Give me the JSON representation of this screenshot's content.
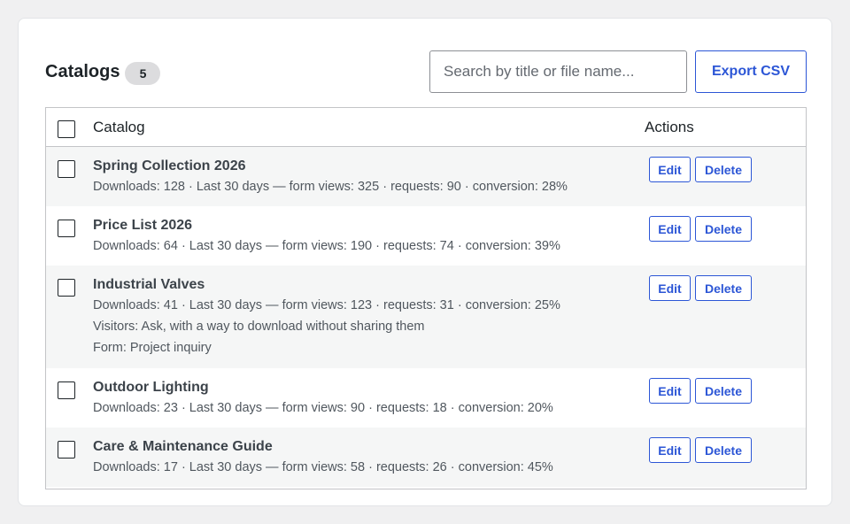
{
  "header": {
    "title": "Catalogs",
    "count": "5",
    "search_placeholder": "Search by title or file name...",
    "export_label": "Export CSV"
  },
  "table": {
    "col_catalog": "Catalog",
    "col_actions": "Actions",
    "edit_label": "Edit",
    "delete_label": "Delete",
    "rows": [
      {
        "title": "Spring Collection 2026",
        "lines": [
          "Downloads: 128 · Last 30 days — form views: 325 · requests: 90 · conversion: 28%"
        ]
      },
      {
        "title": "Price List 2026",
        "lines": [
          "Downloads: 64 · Last 30 days — form views: 190 · requests: 74 · conversion: 39%"
        ]
      },
      {
        "title": "Industrial Valves",
        "lines": [
          "Downloads: 41 · Last 30 days — form views: 123 · requests: 31 · conversion: 25%",
          "Visitors: Ask, with a way to download without sharing them",
          "Form: Project inquiry"
        ]
      },
      {
        "title": "Outdoor Lighting",
        "lines": [
          "Downloads: 23 · Last 30 days — form views: 90 · requests: 18 · conversion: 20%"
        ]
      },
      {
        "title": "Care & Maintenance Guide",
        "lines": [
          "Downloads: 17 · Last 30 days — form views: 58 · requests: 26 · conversion: 45%"
        ]
      }
    ]
  },
  "colors": {
    "accent": "#2c56d6",
    "row_alt": "#f5f6f6",
    "badge_bg": "#dcdcde"
  }
}
